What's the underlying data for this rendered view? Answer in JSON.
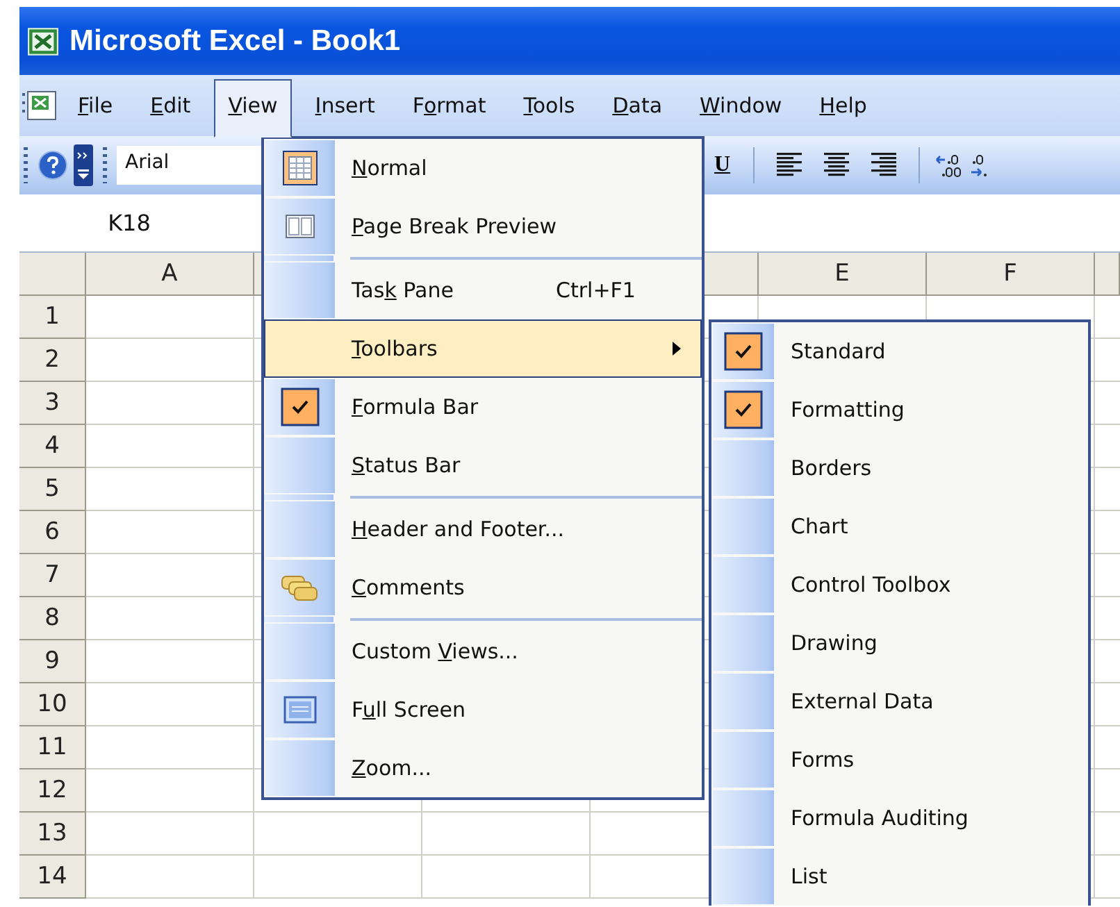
{
  "window": {
    "title": "Microsoft Excel - Book1"
  },
  "menu_bar": [
    {
      "key": "F",
      "post": "ile",
      "selected": false
    },
    {
      "key": "E",
      "post": "dit",
      "selected": false
    },
    {
      "key": "V",
      "post": "iew",
      "selected": true
    },
    {
      "key": "I",
      "post": "nsert",
      "selected": false
    },
    {
      "pre": "F",
      "key": "o",
      "post": "rmat",
      "selected": false
    },
    {
      "key": "T",
      "post": "ools",
      "selected": false
    },
    {
      "key": "D",
      "post": "ata",
      "selected": false
    },
    {
      "key": "W",
      "post": "indow",
      "selected": false
    },
    {
      "key": "H",
      "post": "elp",
      "selected": false
    }
  ],
  "toolbar": {
    "font": "Arial",
    "underline": "U"
  },
  "name_box": "K18",
  "columns": [
    "A",
    "E",
    "F"
  ],
  "rows": [
    "1",
    "2",
    "3",
    "4",
    "5",
    "6",
    "7",
    "8",
    "9",
    "10",
    "11",
    "12",
    "13",
    "14"
  ],
  "view_menu": [
    {
      "kind": "item",
      "key": "N",
      "post": "ormal",
      "checked": true,
      "selected": false
    },
    {
      "kind": "item",
      "key": "P",
      "post": "age Break Preview",
      "checked": false,
      "selected": false
    },
    {
      "kind": "separator"
    },
    {
      "kind": "item",
      "pre": "Tas",
      "key": "k",
      "post": " Pane",
      "shortcut": "Ctrl+F1",
      "checked": false,
      "selected": false
    },
    {
      "kind": "submenu",
      "key": "T",
      "post": "oolbars",
      "checked": false,
      "selected": true
    },
    {
      "kind": "item",
      "key": "F",
      "post": "ormula Bar",
      "checked": true,
      "selected": false
    },
    {
      "kind": "item",
      "key": "S",
      "post": "tatus Bar",
      "checked": false,
      "selected": false
    },
    {
      "kind": "separator"
    },
    {
      "kind": "item",
      "key": "H",
      "post": "eader and Footer...",
      "checked": false,
      "selected": false
    },
    {
      "kind": "item",
      "key": "C",
      "post": "omments",
      "checked": false,
      "selected": false
    },
    {
      "kind": "separator"
    },
    {
      "kind": "item",
      "pre": "Custom ",
      "key": "V",
      "post": "iews...",
      "checked": false,
      "selected": false
    },
    {
      "kind": "item",
      "pre": "F",
      "key": "u",
      "post": "ll Screen",
      "checked": false,
      "selected": false
    },
    {
      "kind": "item",
      "key": "Z",
      "post": "oom...",
      "checked": false,
      "selected": false
    }
  ],
  "toolbars_submenu": [
    {
      "label": "Standard",
      "checked": true
    },
    {
      "label": "Formatting",
      "checked": true
    },
    {
      "label": "Borders",
      "checked": false
    },
    {
      "label": "Chart",
      "checked": false
    },
    {
      "label": "Control Toolbox",
      "checked": false
    },
    {
      "label": "Drawing",
      "checked": false
    },
    {
      "label": "External Data",
      "checked": false
    },
    {
      "label": "Forms",
      "checked": false
    },
    {
      "label": "Formula Auditing",
      "checked": false
    },
    {
      "label": "List",
      "checked": false
    }
  ]
}
